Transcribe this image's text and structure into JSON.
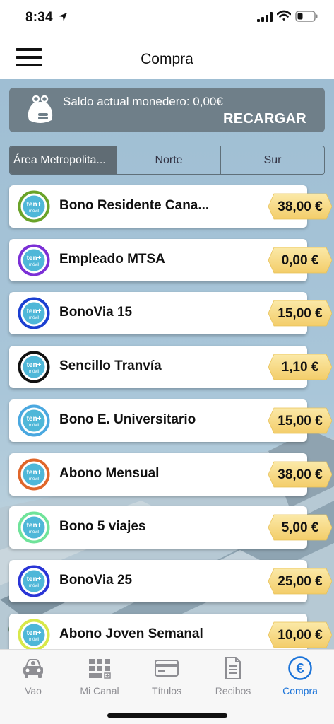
{
  "status": {
    "time": "8:34"
  },
  "header": {
    "title": "Compra"
  },
  "wallet": {
    "label": "Saldo actual monedero: 0,00€",
    "recharge_label": "RECARGAR"
  },
  "tabs": [
    {
      "label": "Área Metropolita...",
      "active": true
    },
    {
      "label": "Norte",
      "active": false
    },
    {
      "label": "Sur",
      "active": false
    }
  ],
  "logo_text": {
    "line1": "ten+",
    "line2": "móvil"
  },
  "products": [
    {
      "name": "Bono Residente Cana...",
      "price": "38,00 €",
      "ring_color": "#6aa329"
    },
    {
      "name": "Empleado MTSA",
      "price": "0,00 €",
      "ring_color": "#7b2fd6"
    },
    {
      "name": "BonoVia 15",
      "price": "15,00 €",
      "ring_color": "#1b3fd1"
    },
    {
      "name": "Sencillo Tranvía",
      "price": "1,10 €",
      "ring_color": "#111111"
    },
    {
      "name": "Bono E. Universitario",
      "price": "15,00 €",
      "ring_color": "#4aa8e0"
    },
    {
      "name": "Abono Mensual",
      "price": "38,00 €",
      "ring_color": "#e0662a"
    },
    {
      "name": "Bono 5 viajes",
      "price": "5,00 €",
      "ring_color": "#6fe39a"
    },
    {
      "name": "BonoVia 25",
      "price": "25,00 €",
      "ring_color": "#2a35d6"
    },
    {
      "name": "Abono Joven Semanal",
      "price": "10,00 €",
      "ring_color": "#d8e84a"
    }
  ],
  "bottom_nav": [
    {
      "label": "Vao",
      "icon": "car-icon",
      "active": false
    },
    {
      "label": "Mi Canal",
      "icon": "grid-icon",
      "active": false
    },
    {
      "label": "Títulos",
      "icon": "card-icon",
      "active": false
    },
    {
      "label": "Recibos",
      "icon": "receipt-icon",
      "active": false
    },
    {
      "label": "Compra",
      "icon": "euro-icon",
      "active": true
    }
  ],
  "colors": {
    "accent": "#1a73d9",
    "wallet_bg": "#6f7f89",
    "price_tag": "#f8dc8a"
  }
}
